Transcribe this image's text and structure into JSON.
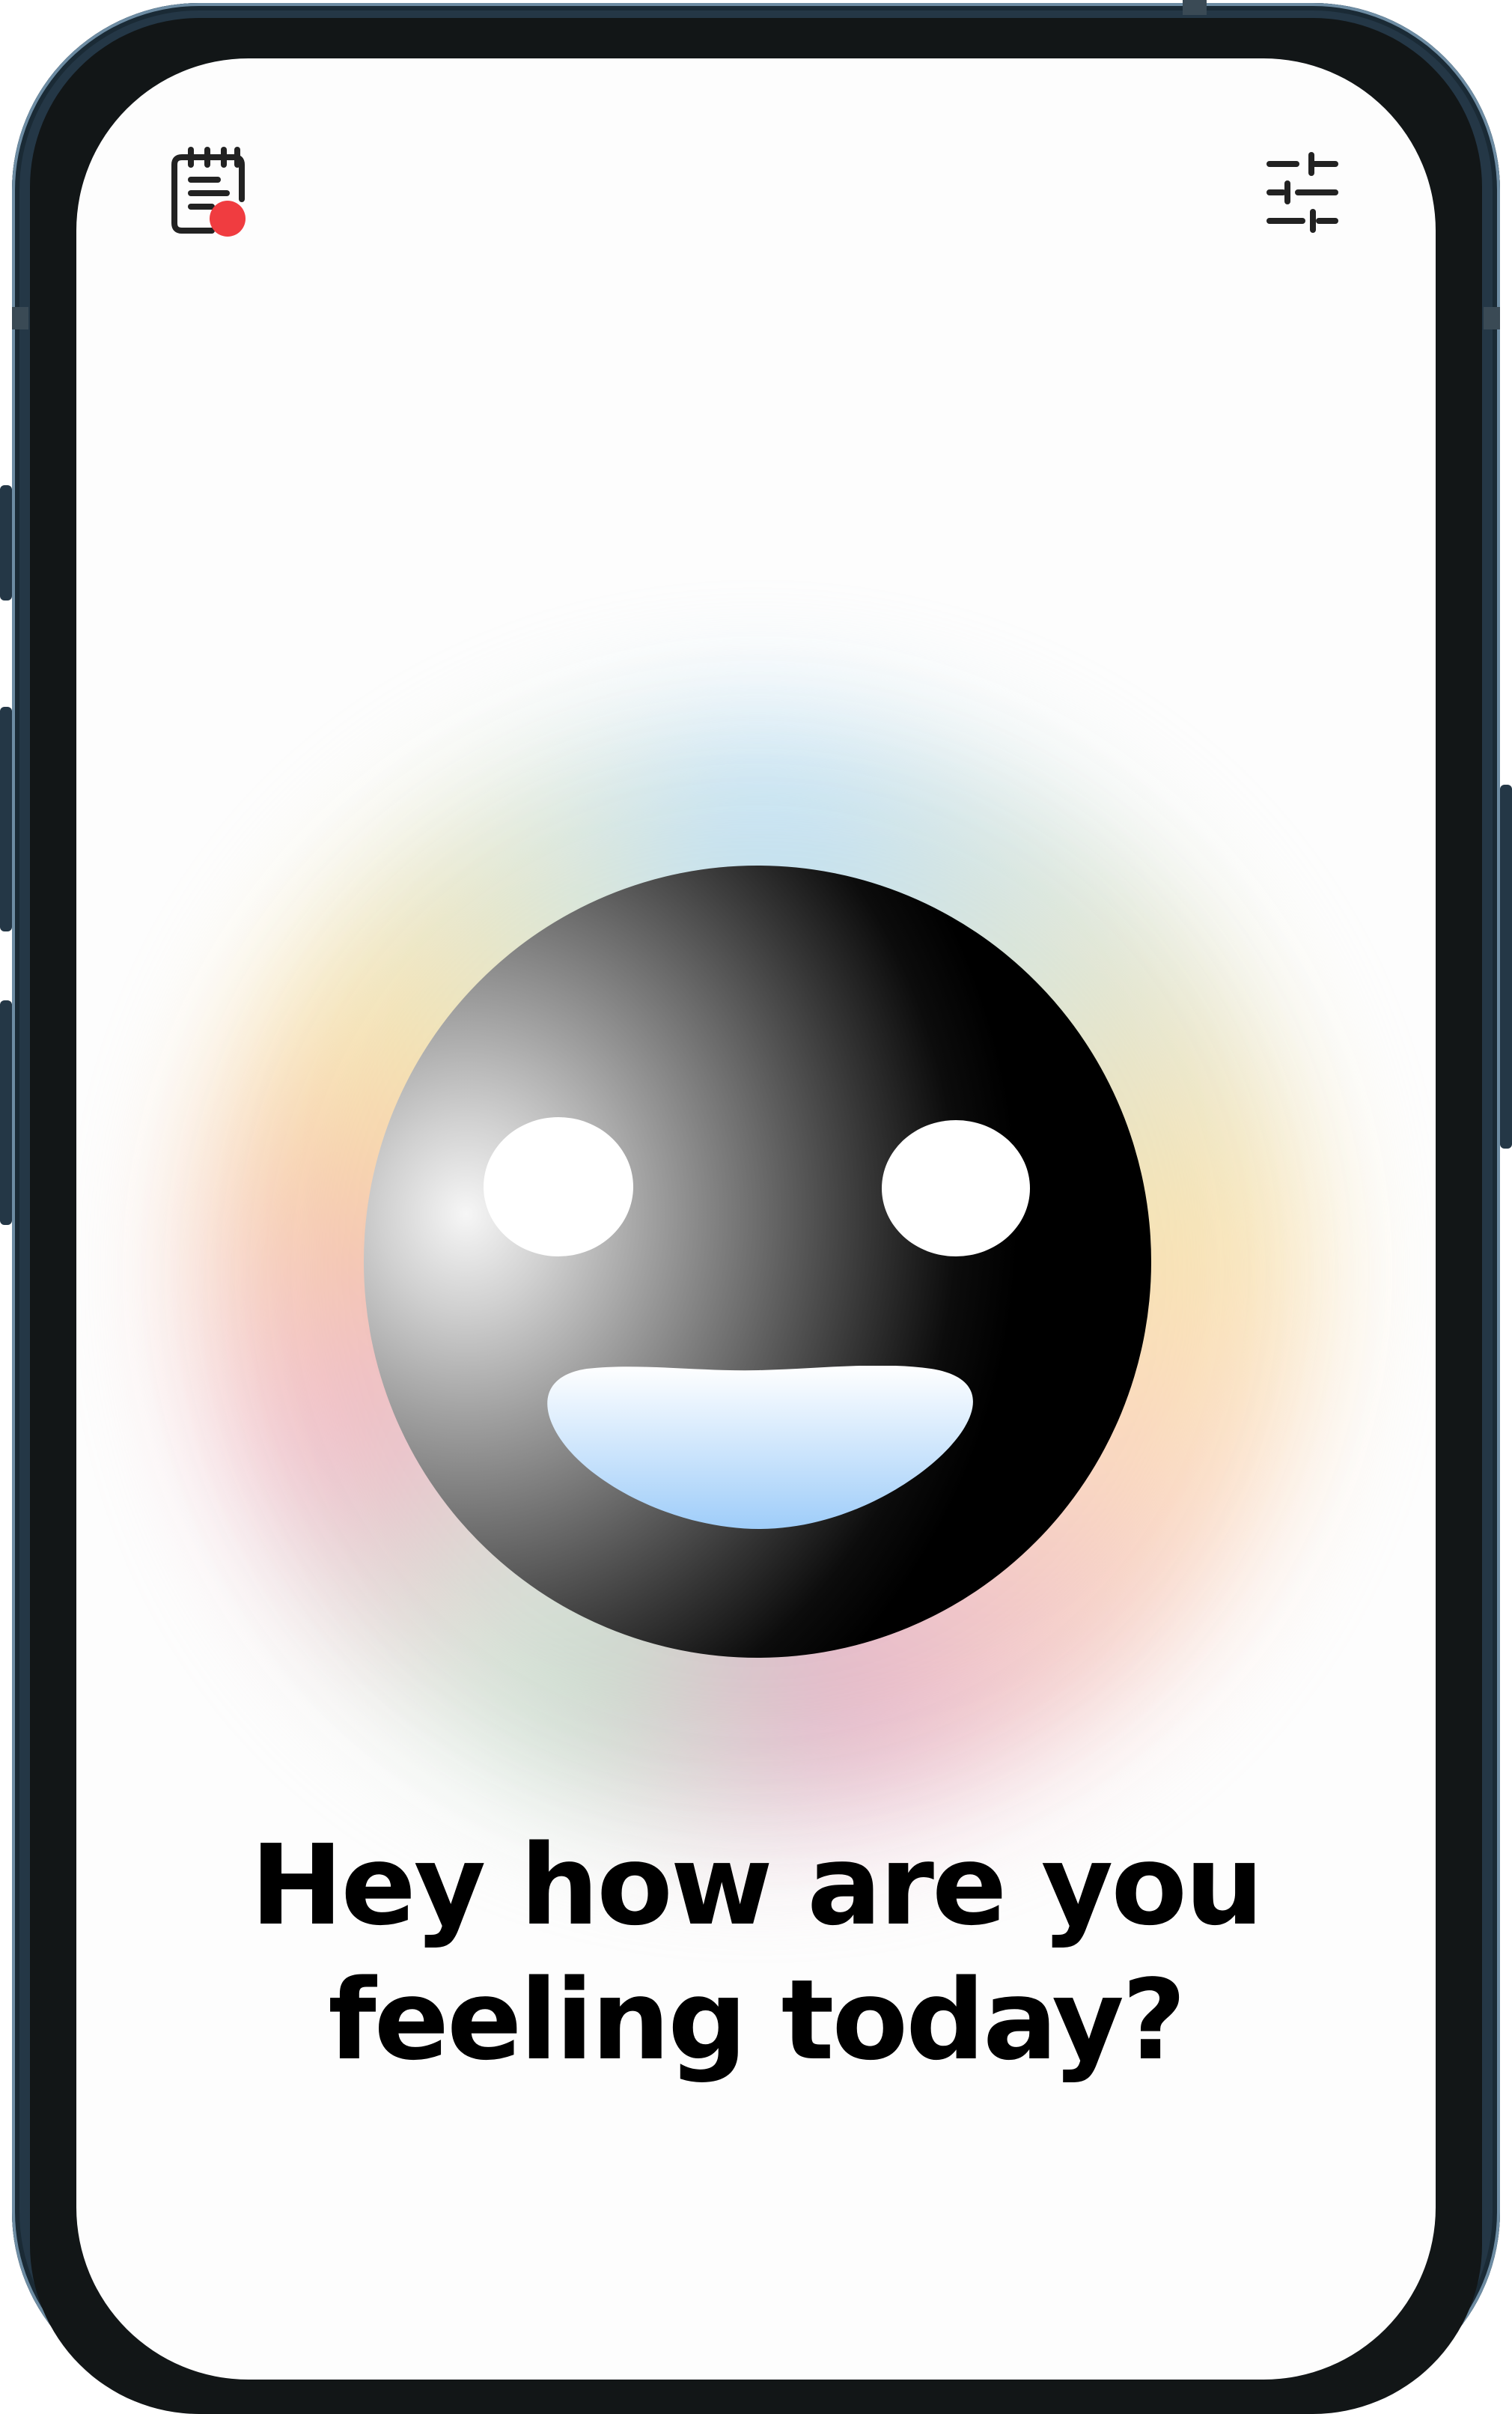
{
  "top_bar": {
    "journal_icon": "journal-notepad-icon",
    "notification_dot_color": "#f03c40",
    "settings_icon": "sliders-icon"
  },
  "mood": {
    "face_icon": "smiley-face",
    "mouth_gradient": [
      "#ffffff",
      "#9fcdf9"
    ]
  },
  "prompt": {
    "line1": "Hey how are you",
    "line2": "feeling today?"
  }
}
